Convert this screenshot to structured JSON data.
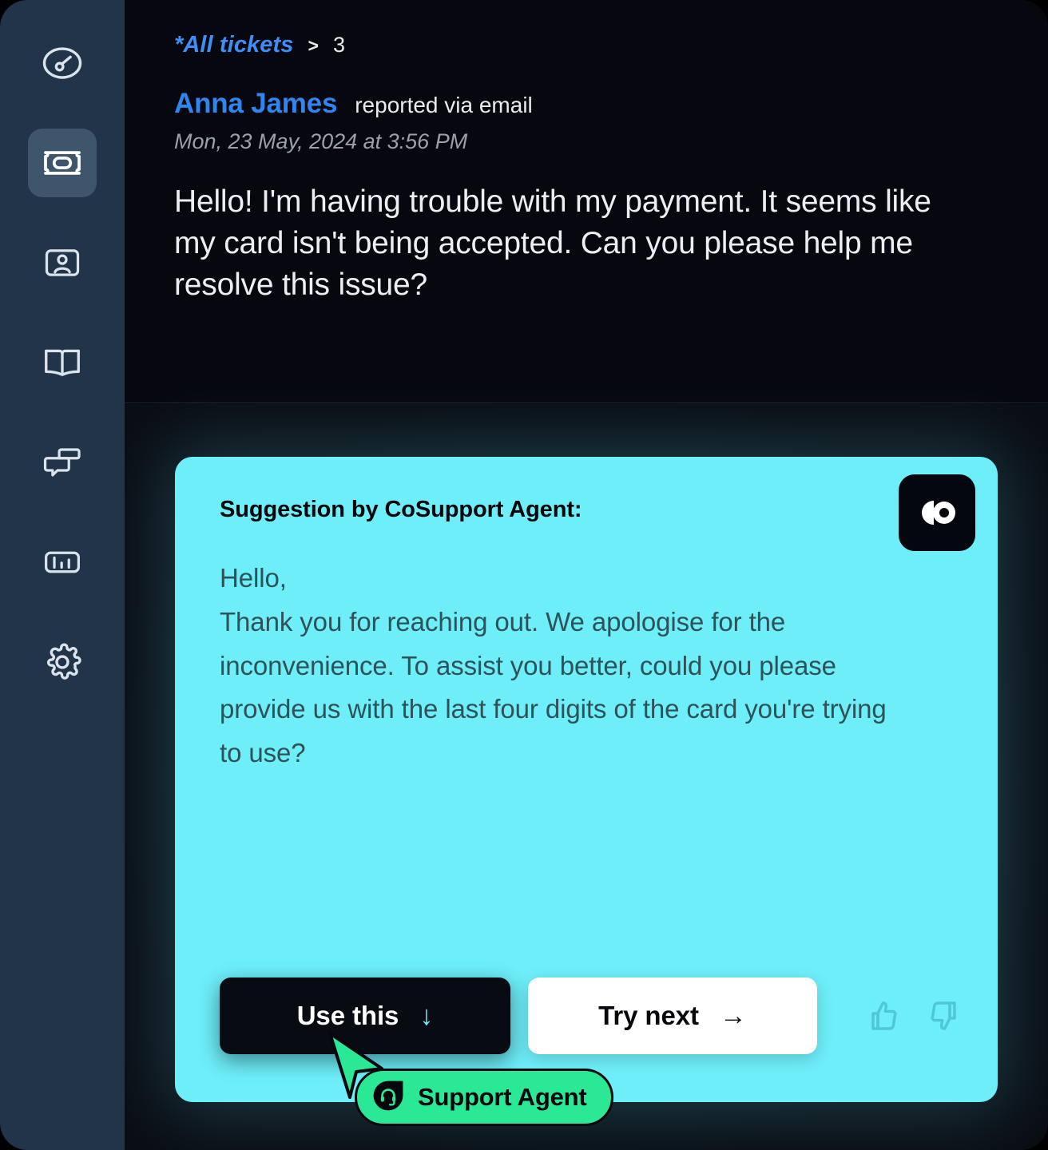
{
  "theme": {
    "accent_cyan": "#6DEEF9",
    "accent_blue": "#2E86F0",
    "accent_green": "#2BE896",
    "sidebar_bg": "#22344A",
    "main_bg": "#07080F",
    "card_text": "#2F5258"
  },
  "sidebar": {
    "items": [
      {
        "name": "dashboard",
        "icon": "gauge-icon",
        "active": false
      },
      {
        "name": "tickets",
        "icon": "ticket-icon",
        "active": true
      },
      {
        "name": "contacts",
        "icon": "contact-card-icon",
        "active": false
      },
      {
        "name": "knowledge-base",
        "icon": "book-icon",
        "active": false
      },
      {
        "name": "conversations",
        "icon": "chat-bubbles-icon",
        "active": false
      },
      {
        "name": "analytics",
        "icon": "bar-chart-icon",
        "active": false
      },
      {
        "name": "settings",
        "icon": "gear-icon",
        "active": false
      }
    ]
  },
  "breadcrumb": {
    "parent": "*All tickets",
    "separator": ">",
    "current": "3"
  },
  "ticket": {
    "reporter": "Anna James",
    "reported_via": "reported via email",
    "timestamp": "Mon, 23 May, 2024 at 3:56 PM",
    "message": "Hello! I'm having trouble with my payment. It seems like my card isn't being accepted. Can you please help me resolve this issue?"
  },
  "suggestion": {
    "title": "Suggestion by CoSupport Agent:",
    "logo_icon": "cosupport-logo-icon",
    "body": "Hello,\nThank you for reaching out. We apologise for the inconvenience. To assist you better, could you please provide us with the last four digits of the card you're trying to use?",
    "use_label": "Use this",
    "use_arrow": "↓",
    "next_label": "Try next",
    "next_arrow": "→",
    "thumbs_up_icon": "thumbs-up-icon",
    "thumbs_down_icon": "thumbs-down-icon"
  },
  "role_badge": {
    "label": "Support Agent",
    "icon": "support-agent-icon"
  },
  "cursor": {
    "icon": "mouse-pointer-icon"
  }
}
